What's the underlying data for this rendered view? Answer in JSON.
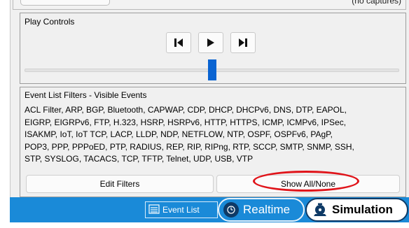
{
  "top": {
    "capture_status": "(no captures)"
  },
  "play_controls": {
    "title": "Play Controls",
    "back_icon": "skip-back-icon",
    "play_icon": "play-icon",
    "forward_icon": "skip-forward-icon",
    "slider_position_fraction": 0.5
  },
  "event_filters": {
    "title": "Event List Filters - Visible Events",
    "lines": [
      "ACL Filter, ARP, BGP, Bluetooth, CAPWAP, CDP, DHCP, DHCPv6, DNS, DTP, EAPOL,",
      "EIGRP, EIGRPv6, FTP, H.323, HSRP, HSRPv6, HTTP, HTTPS, ICMP, ICMPv6, IPSec,",
      "ISAKMP, IoT, IoT TCP, LACP, LLDP, NDP, NETFLOW, NTP, OSPF, OSPFv6, PAgP,",
      "POP3, PPP, PPPoED, PTP, RADIUS, REP, RIP, RIPng, RTP, SCCP, SMTP, SNMP, SSH,",
      "STP, SYSLOG, TACACS, TCP, TFTP, Telnet, UDP, USB, VTP"
    ],
    "edit_label": "Edit Filters",
    "show_all_label": "Show All/None"
  },
  "mode_bar": {
    "event_list_label": "Event List",
    "realtime_label": "Realtime",
    "simulation_label": "Simulation",
    "accent_color": "#1a8ad8",
    "highlight_color": "#e0141a"
  }
}
